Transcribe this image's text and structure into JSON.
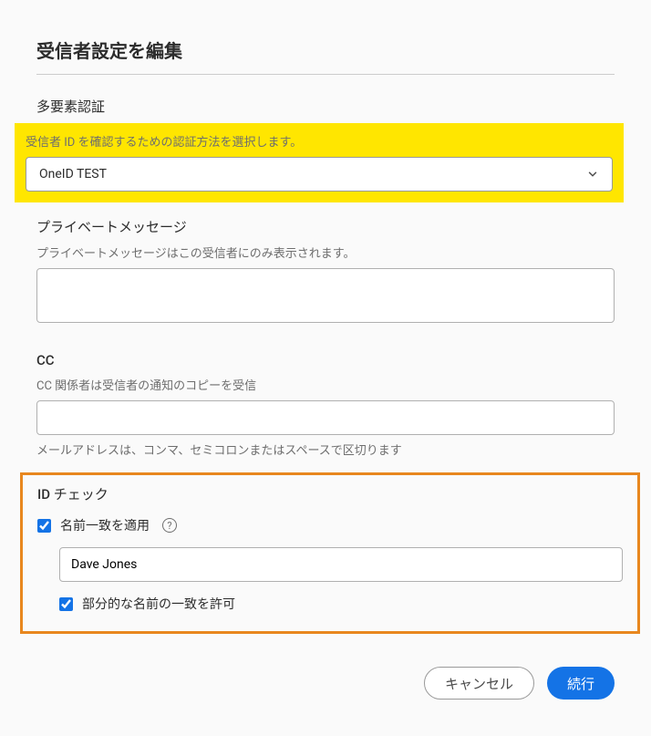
{
  "title": "受信者設定を編集",
  "mfa": {
    "label": "多要素認証",
    "hint": "受信者 ID を確認するための認証方法を選択します。",
    "selected": "OneID TEST"
  },
  "privateMessage": {
    "label": "プライベートメッセージ",
    "hint": "プライベートメッセージはこの受信者にのみ表示されます。",
    "value": ""
  },
  "cc": {
    "label": "CC",
    "hint": "CC 関係者は受信者の通知のコピーを受信",
    "value": "",
    "hintBelow": "メールアドレスは、コンマ、セミコロンまたはスペースで区切ります"
  },
  "idCheck": {
    "label": "ID チェック",
    "applyNameMatch": {
      "checked": true,
      "label": "名前一致を適用"
    },
    "nameValue": "Dave Jones",
    "allowPartial": {
      "checked": true,
      "label": "部分的な名前の一致を許可"
    }
  },
  "buttons": {
    "cancel": "キャンセル",
    "continue": "続行"
  }
}
